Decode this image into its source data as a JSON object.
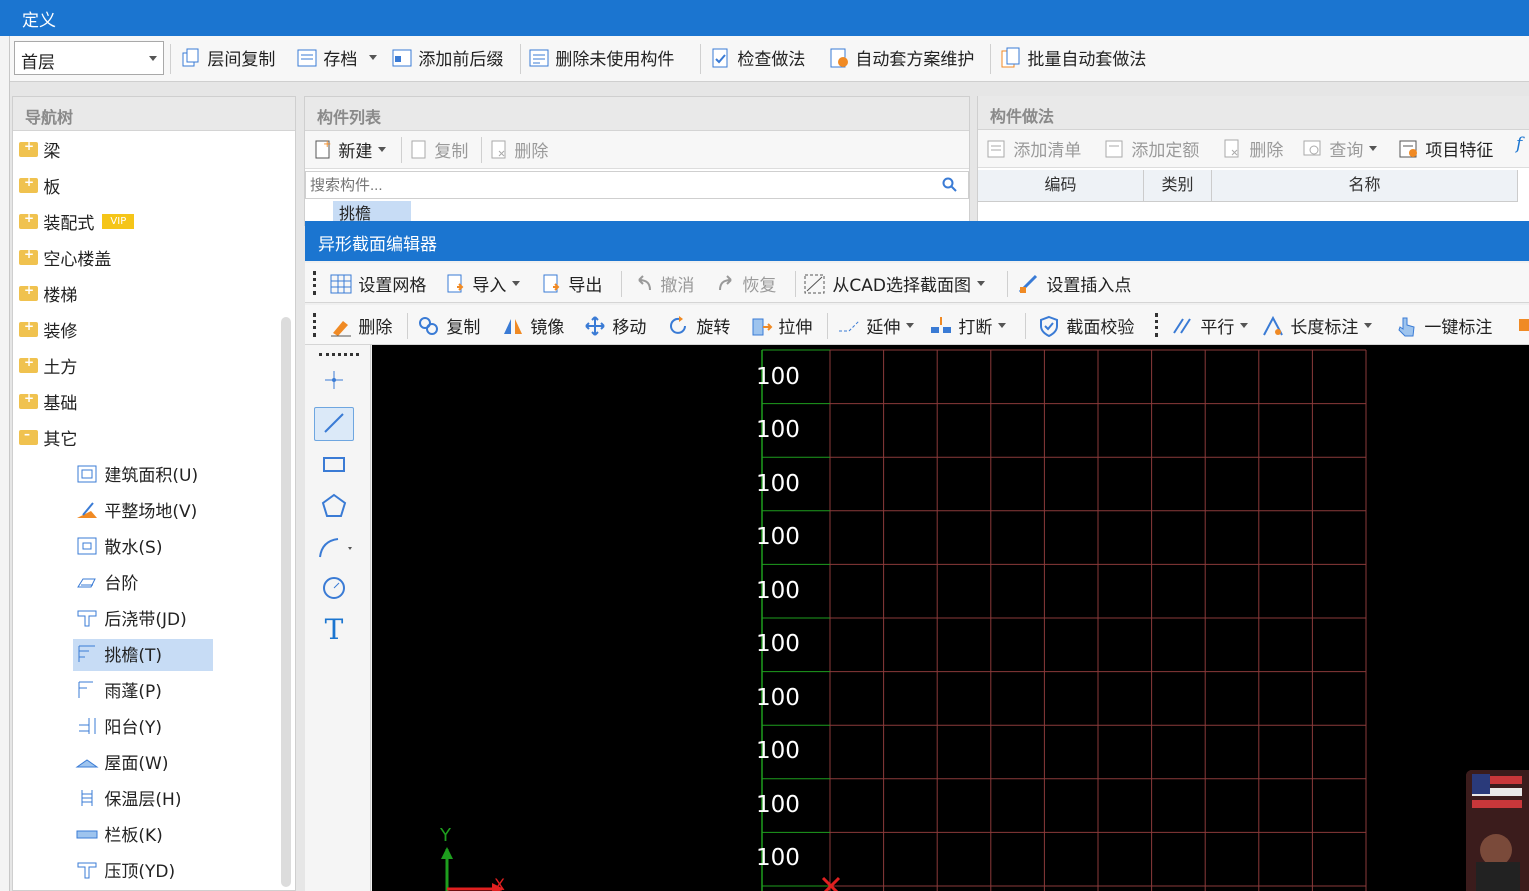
{
  "window": {
    "title": "定义"
  },
  "toolbar": {
    "floor": "首层",
    "buttons": [
      "层间复制",
      "存档",
      "添加前后缀",
      "删除未使用构件",
      "检查做法",
      "自动套方案维护",
      "批量自动套做法"
    ]
  },
  "nav": {
    "title": "导航树",
    "folders": [
      "梁",
      "板",
      "装配式",
      "空心楼盖",
      "楼梯",
      "装修",
      "土方",
      "基础",
      "其它"
    ],
    "vip_badge": "VIP",
    "children": [
      "建筑面积(U)",
      "平整场地(V)",
      "散水(S)",
      "台阶",
      "后浇带(JD)",
      "挑檐(T)",
      "雨蓬(P)",
      "阳台(Y)",
      "屋面(W)",
      "保温层(H)",
      "栏板(K)",
      "压顶(YD)"
    ],
    "selected": "挑檐(T)"
  },
  "complist": {
    "title": "构件列表",
    "new_label": "新建",
    "copy_label": "复制",
    "delete_label": "删除",
    "search_placeholder": "搜索构件...",
    "partial_item": "挑檐"
  },
  "work": {
    "title": "构件做法",
    "buttons": [
      "添加清单",
      "添加定额",
      "删除",
      "查询",
      "项目特征"
    ],
    "columns": [
      "编码",
      "类别",
      "名称"
    ]
  },
  "editor": {
    "title": "异形截面编辑器",
    "row1": [
      "设置网格",
      "导入",
      "导出",
      "撤消",
      "恢复",
      "从CAD选择截面图",
      "设置插入点"
    ],
    "row2": [
      "删除",
      "复制",
      "镜像",
      "移动",
      "旋转",
      "拉伸",
      "延伸",
      "打断",
      "截面校验",
      "平行",
      "长度标注",
      "一键标注"
    ],
    "grid_labels": [
      "100",
      "100",
      "100",
      "100",
      "100",
      "100",
      "100",
      "100",
      "100",
      "100"
    ],
    "axis_y": "Y",
    "axis_x": "X",
    "text_tool": "T"
  },
  "colors": {
    "accent": "#1b75d0",
    "grid": "#8a3a3a",
    "axis": "#1e9e1e"
  }
}
